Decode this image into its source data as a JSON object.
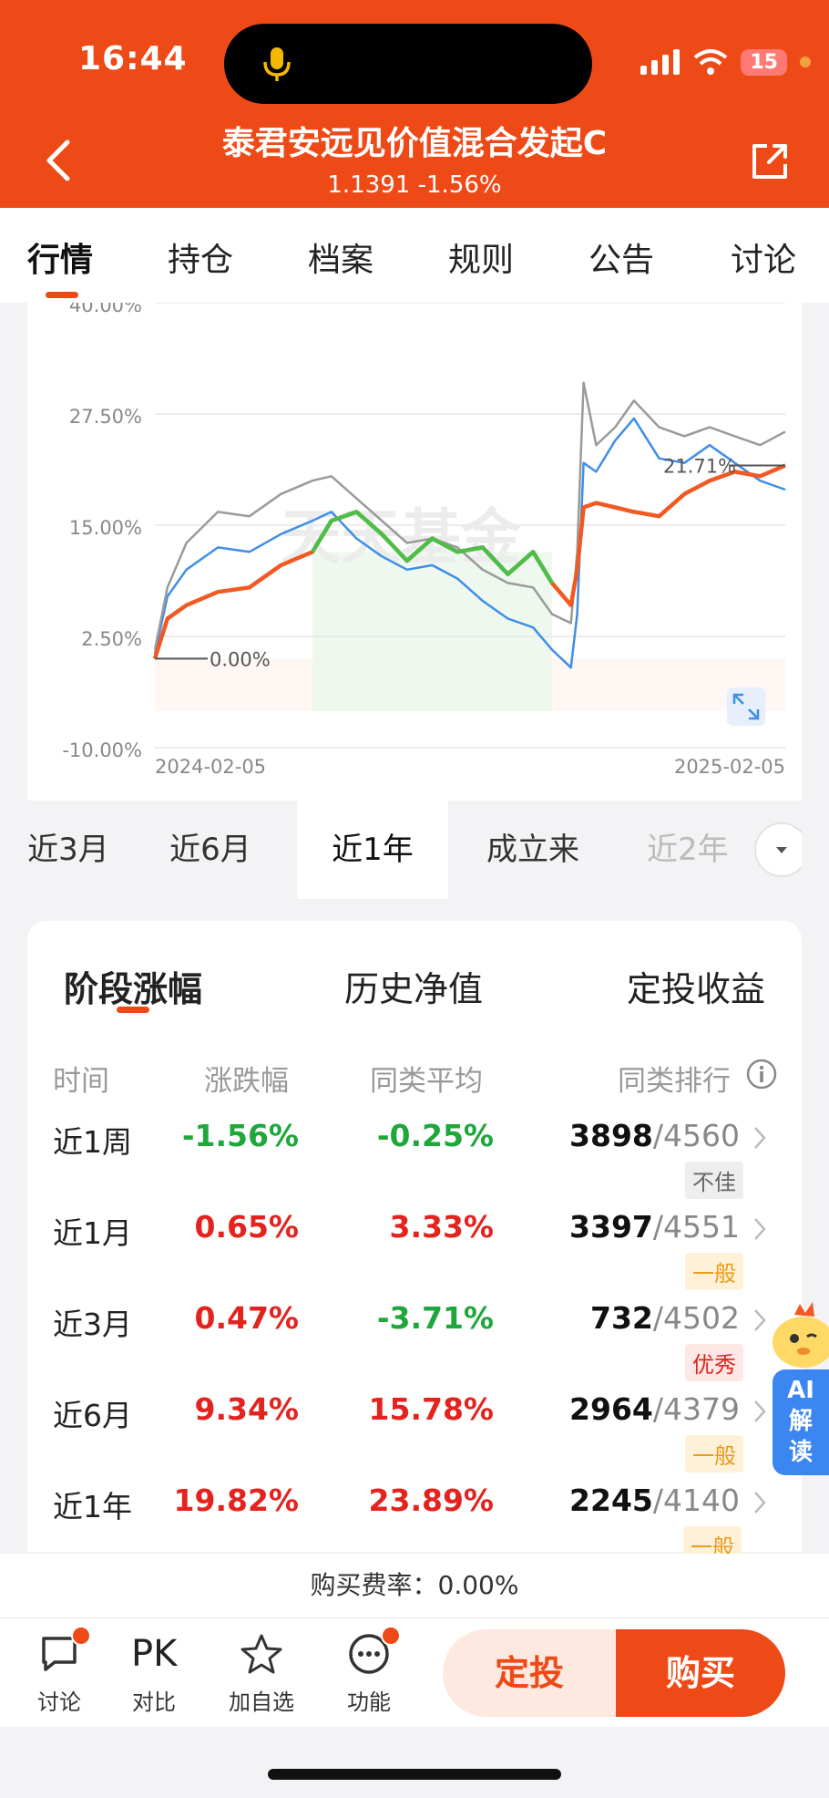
{
  "status_bar": {
    "time": "16:44",
    "battery": "15"
  },
  "header": {
    "title": "泰君安远见价值混合发起C",
    "subtitle": "1.1391 -1.56%"
  },
  "tabs": [
    "行情",
    "持仓",
    "档案",
    "规则",
    "公告",
    "讨论"
  ],
  "chart_data": {
    "type": "line",
    "x_range": [
      "2024-02-05",
      "2025-02-05"
    ],
    "ylim": [
      -10.0,
      40.0
    ],
    "y_ticks": [
      "-10.00%",
      "2.50%",
      "15.00%",
      "27.50%",
      "40.00%"
    ],
    "x_ticks": [
      "2024-02-05",
      "2025-02-05"
    ],
    "annotations": {
      "start": "0.00%",
      "end": "21.71%"
    },
    "watermark": "天天基金",
    "series": [
      {
        "color": "#f05a22",
        "x": [
          0,
          0.02,
          0.05,
          0.1,
          0.15,
          0.2,
          0.25,
          0.28,
          0.32,
          0.36,
          0.4,
          0.44,
          0.48,
          0.52,
          0.56,
          0.6,
          0.63,
          0.66,
          0.67,
          0.68,
          0.7,
          0.73,
          0.76,
          0.8,
          0.84,
          0.88,
          0.92,
          0.96,
          1.0
        ],
        "y": [
          0.0,
          4.5,
          6.0,
          7.5,
          8.0,
          10.5,
          12.0,
          15.5,
          16.5,
          14.0,
          11.0,
          13.5,
          12.0,
          12.5,
          9.5,
          12.0,
          8.5,
          6.0,
          10.0,
          17.0,
          17.5,
          17.0,
          16.5,
          16.0,
          18.5,
          20.0,
          21.0,
          20.5,
          21.71
        ]
      },
      {
        "color": "#9a9a9a",
        "x": [
          0,
          0.02,
          0.05,
          0.1,
          0.15,
          0.2,
          0.25,
          0.28,
          0.32,
          0.36,
          0.4,
          0.44,
          0.48,
          0.52,
          0.56,
          0.6,
          0.63,
          0.66,
          0.67,
          0.68,
          0.7,
          0.73,
          0.76,
          0.8,
          0.84,
          0.88,
          0.92,
          0.96,
          1.0
        ],
        "y": [
          1.0,
          8.0,
          13.0,
          16.5,
          16.0,
          18.5,
          20.0,
          20.5,
          18.0,
          15.5,
          13.0,
          13.5,
          12.5,
          10.0,
          8.5,
          8.0,
          5.0,
          4.0,
          12.0,
          31.0,
          24.0,
          26.0,
          29.0,
          26.0,
          25.0,
          26.0,
          25.0,
          24.0,
          25.5
        ]
      },
      {
        "color": "#3f8ee8",
        "x": [
          0,
          0.02,
          0.05,
          0.1,
          0.15,
          0.2,
          0.25,
          0.28,
          0.32,
          0.36,
          0.4,
          0.44,
          0.48,
          0.52,
          0.56,
          0.6,
          0.63,
          0.66,
          0.67,
          0.68,
          0.7,
          0.73,
          0.76,
          0.8,
          0.84,
          0.88,
          0.92,
          0.96,
          1.0
        ],
        "y": [
          0.5,
          7.0,
          10.0,
          12.5,
          12.0,
          14.0,
          15.5,
          16.5,
          13.5,
          11.5,
          10.0,
          10.5,
          9.0,
          6.5,
          4.5,
          3.5,
          1.0,
          -1.0,
          5.0,
          22.0,
          21.0,
          24.5,
          27.0,
          22.5,
          22.0,
          24.0,
          22.0,
          20.0,
          19.0
        ]
      }
    ],
    "highlight_series_color": "#4cbf4a",
    "highlight_range": [
      0.25,
      0.63
    ]
  },
  "periods": [
    "近3月",
    "近6月",
    "近1年",
    "成立来",
    "近2年"
  ],
  "perf": {
    "tabs": [
      "阶段涨幅",
      "历史净值",
      "定投收益"
    ],
    "headers": [
      "时间",
      "涨跌幅",
      "同类平均",
      "同类排行"
    ],
    "rows": [
      {
        "label": "近1周",
        "change": "-1.56%",
        "avg": "-0.25%",
        "rank": "3898",
        "total": "/4560",
        "badge": "不佳"
      },
      {
        "label": "近1月",
        "change": "0.65%",
        "avg": "3.33%",
        "rank": "3397",
        "total": "/4551",
        "badge": "一般"
      },
      {
        "label": "近3月",
        "change": "0.47%",
        "avg": "-3.71%",
        "rank": "732",
        "total": "/4502",
        "badge": "优秀"
      },
      {
        "label": "近6月",
        "change": "9.34%",
        "avg": "15.78%",
        "rank": "2964",
        "total": "/4379",
        "badge": "一般"
      },
      {
        "label": "近1年",
        "change": "19.82%",
        "avg": "23.89%",
        "rank": "2245",
        "total": "/4140",
        "badge": "一般"
      }
    ]
  },
  "ai_button": {
    "line1": "AI",
    "line2": "解",
    "line3": "读"
  },
  "fee": {
    "text": "购买费率：0.00%"
  },
  "bottom_bar": {
    "items": [
      {
        "label": "讨论",
        "icon": "chat-icon"
      },
      {
        "label": "对比",
        "icon_text": "PK"
      },
      {
        "label": "加自选",
        "icon": "star-icon"
      },
      {
        "label": "功能",
        "icon": "more-icon"
      }
    ],
    "dingtou": "定投",
    "buy": "购买"
  },
  "colors": {
    "brand": "#ee4a18",
    "up": "#e4231f",
    "down": "#1fa73b"
  }
}
